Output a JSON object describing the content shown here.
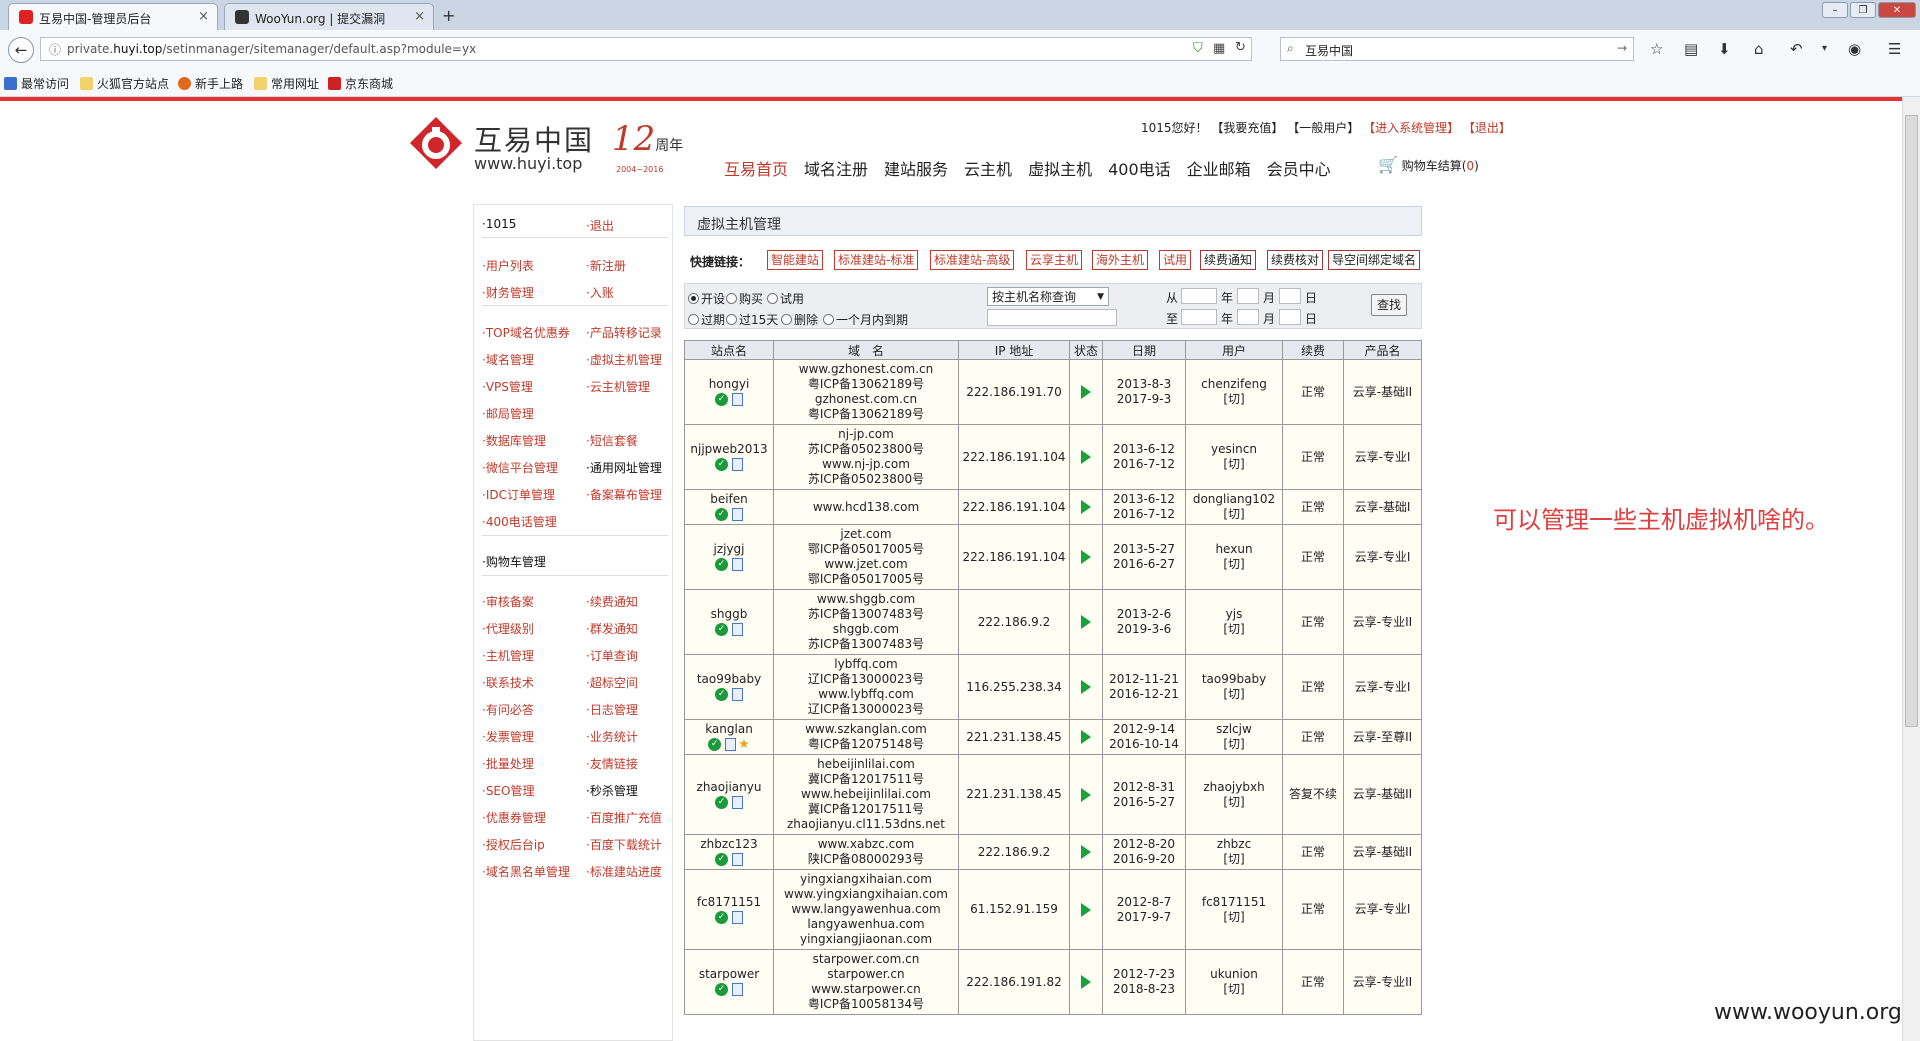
{
  "browser": {
    "tabs": [
      {
        "title": "互易中国-管理员后台",
        "close": "×"
      },
      {
        "title": "WooYun.org | 提交漏洞",
        "close": "×"
      }
    ],
    "new_tab": "+",
    "url_prefix": "private.",
    "url_domain": "huyi.top",
    "url_path": "/setinmanager/sitemanager/default.asp?module=yx",
    "search_text": "互易中国",
    "bookmarks": [
      "最常访问",
      "火狐官方站点",
      "新手上路",
      "常用网址",
      "京东商城"
    ]
  },
  "site": {
    "logo_text": "互易中国",
    "logo_url": "www.huyi.top",
    "anniv_num": "12",
    "anniv_word": "周年",
    "anniv_years": "2004~2016",
    "user_links": {
      "greeting": "1015您好！",
      "recharge": "【我要充值】",
      "general_user": "【一般用户】",
      "enter_admin": "【进入系统管理】",
      "logout": "【退出】"
    },
    "nav": [
      "互易首页",
      "域名注册",
      "建站服务",
      "云主机",
      "虚拟主机",
      "400电话",
      "企业邮箱",
      "会员中心"
    ],
    "cart_label": "购物车结算(",
    "cart_count": "0",
    "cart_close": ")"
  },
  "leftmenu": {
    "top": [
      [
        "·1015",
        "·退出"
      ]
    ],
    "group1": [
      [
        "·用户列表",
        "·新注册"
      ],
      [
        "·财务管理",
        "·入账"
      ]
    ],
    "group2": [
      [
        "·TOP域名优惠券",
        "·产品转移记录"
      ],
      [
        "·域名管理",
        "·虚拟主机管理"
      ],
      [
        "·VPS管理",
        "·云主机管理"
      ],
      [
        "·邮局管理",
        ""
      ],
      [
        "·数据库管理",
        "·短信套餐"
      ],
      [
        "·微信平台管理",
        "·通用网址管理"
      ],
      [
        "·IDC订单管理",
        "·备案幕布管理"
      ],
      [
        "·400电话管理",
        ""
      ]
    ],
    "cart": "·购物车管理",
    "group3": [
      [
        "·审核备案",
        "·续费通知"
      ],
      [
        "·代理级别",
        "·群发通知"
      ],
      [
        "·主机管理",
        "·订单查询"
      ],
      [
        "·联系技术",
        "·超标空间"
      ],
      [
        "·有问必答",
        "·日志管理"
      ],
      [
        "·发票管理",
        "·业务统计"
      ],
      [
        "·批量处理",
        "·友情链接"
      ],
      [
        "·SEO管理",
        "·秒杀管理"
      ],
      [
        "·优惠券管理",
        "·百度推广充值"
      ],
      [
        "·授权后台ip",
        "·百度下载统计"
      ],
      [
        "·域名黑名单管理",
        "·标准建站进度"
      ]
    ]
  },
  "content": {
    "title": "虚拟主机管理",
    "quick_label": "快捷链接：",
    "quick_links": [
      "智能建站",
      "标准建站-标准",
      "标准建站-高级",
      "云享主机",
      "海外主机",
      "试用",
      "续费通知",
      "续费核对",
      "导空间绑定域名"
    ],
    "filter": {
      "row1": [
        "开设",
        "购买",
        "试用"
      ],
      "row2": [
        "过期",
        "过15天",
        "删除",
        "一个月内到期"
      ],
      "select": "按主机名称查询",
      "from": "从",
      "to": "至",
      "year": "年",
      "month": "月",
      "day": "日",
      "find": "查找"
    },
    "headers": [
      "站点名",
      "域　名",
      "IP 地址",
      "状态",
      "日期",
      "用户",
      "续费",
      "产品名"
    ],
    "rows": [
      {
        "site": "hongyi",
        "domains": [
          "www.gzhonest.com.cn",
          "粤ICP备13062189号",
          "gzhonest.com.cn",
          "粤ICP备13062189号"
        ],
        "ip": "222.186.191.70",
        "dates": [
          "2013-8-3",
          "2017-9-3"
        ],
        "user": "chenzifeng",
        "switch": "[切]",
        "renew": "正常",
        "product": "云享-基础II",
        "star": false
      },
      {
        "site": "njjpweb2013",
        "domains": [
          "nj-jp.com",
          "苏ICP备05023800号",
          "www.nj-jp.com",
          "苏ICP备05023800号"
        ],
        "ip": "222.186.191.104",
        "dates": [
          "2013-6-12",
          "2016-7-12"
        ],
        "user": "yesincn",
        "switch": "[切]",
        "renew": "正常",
        "product": "云享-专业I",
        "star": false
      },
      {
        "site": "beifen",
        "domains": [
          "www.hcd138.com"
        ],
        "ip": "222.186.191.104",
        "dates": [
          "2013-6-12",
          "2016-7-12"
        ],
        "user": "dongliang102",
        "switch": "[切]",
        "renew": "正常",
        "product": "云享-基础I",
        "star": false
      },
      {
        "site": "jzjygj",
        "domains": [
          "jzet.com",
          "鄂ICP备05017005号",
          "www.jzet.com",
          "鄂ICP备05017005号"
        ],
        "ip": "222.186.191.104",
        "dates": [
          "2013-5-27",
          "2016-6-27"
        ],
        "user": "hexun",
        "switch": "[切]",
        "renew": "正常",
        "product": "云享-专业I",
        "star": false
      },
      {
        "site": "shggb",
        "domains": [
          "www.shggb.com",
          "苏ICP备13007483号",
          "shggb.com",
          "苏ICP备13007483号"
        ],
        "ip": "222.186.9.2",
        "dates": [
          "2013-2-6",
          "2019-3-6"
        ],
        "user": "yjs",
        "switch": "[切]",
        "renew": "正常",
        "product": "云享-专业II",
        "star": false
      },
      {
        "site": "tao99baby",
        "domains": [
          "lybffq.com",
          "辽ICP备13000023号",
          "www.lybffq.com",
          "辽ICP备13000023号"
        ],
        "ip": "116.255.238.34",
        "dates": [
          "2012-11-21",
          "2016-12-21"
        ],
        "user": "tao99baby",
        "switch": "[切]",
        "renew": "正常",
        "product": "云享-专业I",
        "star": false
      },
      {
        "site": "kanglan",
        "domains": [
          "www.szkanglan.com",
          "粤ICP备12075148号"
        ],
        "ip": "221.231.138.45",
        "dates": [
          "2012-9-14",
          "2016-10-14"
        ],
        "user": "szlcjw",
        "switch": "[切]",
        "renew": "正常",
        "product": "云享-至尊II",
        "star": true
      },
      {
        "site": "zhaojianyu",
        "domains": [
          "hebeijinlilai.com",
          "冀ICP备12017511号",
          "www.hebeijinlilai.com",
          "冀ICP备12017511号",
          "zhaojianyu.cl11.53dns.net"
        ],
        "ip": "221.231.138.45",
        "dates": [
          "2012-8-31",
          "2016-5-27"
        ],
        "user": "zhaojybxh",
        "switch": "[切]",
        "renew": "答复不续",
        "product": "云享-基础II",
        "star": false
      },
      {
        "site": "zhbzc123",
        "domains": [
          "www.xabzc.com",
          "陕ICP备08000293号"
        ],
        "ip": "222.186.9.2",
        "dates": [
          "2012-8-20",
          "2016-9-20"
        ],
        "user": "zhbzc",
        "switch": "[切]",
        "renew": "正常",
        "product": "云享-基础II",
        "star": false
      },
      {
        "site": "fc8171151",
        "domains": [
          "yingxiangxihaian.com",
          "www.yingxiangxihaian.com",
          "www.langyawenhua.com",
          "langyawenhua.com",
          "yingxiangjiaonan.com"
        ],
        "ip": "61.152.91.159",
        "dates": [
          "2012-8-7",
          "2017-9-7"
        ],
        "user": "fc8171151",
        "switch": "[切]",
        "renew": "正常",
        "product": "云享-专业I",
        "star": false
      },
      {
        "site": "starpower",
        "domains": [
          "starpower.com.cn",
          "starpower.cn",
          "www.starpower.cn",
          "粤ICP备10058134号"
        ],
        "ip": "222.186.191.82",
        "dates": [
          "2012-7-23",
          "2018-8-23"
        ],
        "user": "ukunion",
        "switch": "[切]",
        "renew": "正常",
        "product": "云享-专业II",
        "star": false
      }
    ]
  },
  "annotation": "可以管理一些主机虚拟机啥的。",
  "watermark": "www.wooyun.org",
  "colors": {
    "accent_red": "#c0392b",
    "top_line": "#e53333",
    "ok_green": "#1a9a3a"
  }
}
